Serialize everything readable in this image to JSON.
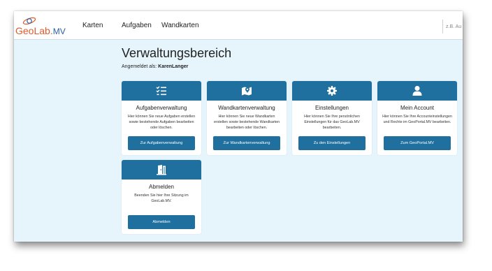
{
  "nav": {
    "logo_main": "GeoLab.",
    "logo_suffix": "MV",
    "links": [
      "Karten",
      "Aufgaben",
      "Wandkarten"
    ],
    "search_placeholder": "z.B. Au"
  },
  "page": {
    "title": "Verwaltungsbereich",
    "logged_in_label": "Angemeldet als:",
    "username": "KarenLanger"
  },
  "cards": [
    {
      "icon": "list-check-icon",
      "title": "Aufgabenverwaltung",
      "text": "Hier können Sie neue Aufgaben erstellen sowie bestehende Aufgaben bearbeiten oder löschen.",
      "button": "Zur Aufgabenverwaltung"
    },
    {
      "icon": "map-marker-icon",
      "title": "Wandkartenverwaltung",
      "text": "Hier können Sie neue Wandkarten erstellen sowie bestehende Wandkarten bearbeiten oder löschen.",
      "button": "Zur Wandkartenverwaltung"
    },
    {
      "icon": "gear-icon",
      "title": "Einstellungen",
      "text": "Hier können Sie Ihre persönlichen Einstellungen für das GeoLab.MV bearbeiten.",
      "button": "Zu den Einstellungen"
    },
    {
      "icon": "user-icon",
      "title": "Mein Account",
      "text": "Hier können Sie Ihre Accounteinstellungen und Rechte im GeoPortal.MV bearbeiten.",
      "button": "Zum GeoPortal.MV"
    },
    {
      "icon": "door-exit-icon",
      "title": "Abmelden",
      "text": "Beenden Sie hier Ihre Sitzung im GeoLab.MV.",
      "button": "Abmelden"
    }
  ],
  "colors": {
    "primary": "#1f6f9f",
    "background": "#e6f4fb",
    "logo_orange": "#e05a2a",
    "logo_blue": "#2b5fa7"
  }
}
